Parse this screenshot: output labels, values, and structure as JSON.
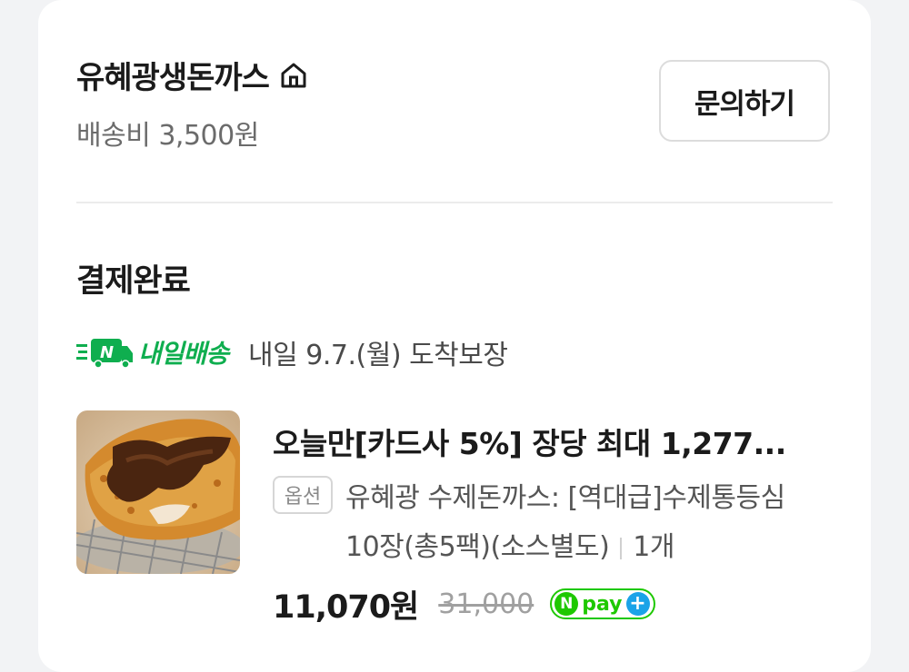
{
  "store": {
    "name": "유혜광생돈까스",
    "home_icon": "home-icon",
    "delivery_fee": "배송비 3,500원",
    "inquiry_label": "문의하기"
  },
  "order": {
    "status": "결제완료",
    "shipping": {
      "badge_label": "내일배송",
      "badge_icon": "truck-n-icon",
      "badge_color": "#0fae4f",
      "eta": "내일 9.7.(월) 도착보장"
    },
    "item": {
      "image_alt": "tonkatsu-thumbnail",
      "title": "오늘만[카드사 5%] 장당 최대 1,277...",
      "option_tag": "옵션",
      "option_text": "유혜광 수제돈까스: [역대급]수제통등심10장(총5팩)(소스별도)",
      "quantity": "1개",
      "price": "11,070원",
      "original_price": "31,000",
      "npay": {
        "n": "N",
        "pay": "pay",
        "plus": "+"
      }
    }
  }
}
